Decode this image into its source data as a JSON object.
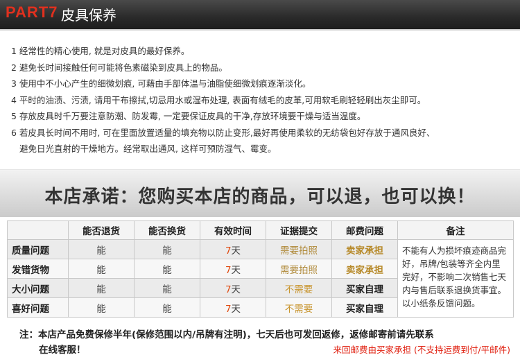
{
  "header": {
    "part": "PART7",
    "title": "皮具保养"
  },
  "care": [
    "1 经常性的精心使用, 就是对皮具的最好保养。",
    "2 避免长时间接触任何可能将色素磁染到皮具上的物品。",
    "3 使用中不小心产生的细微划痕, 可藉由手部体温与油脂使细微划痕逐渐淡化。",
    "4 平时的油渍、污渍, 请用干布擦拭,切忌用水或湿布处理, 表面有绒毛的皮革,可用软毛刷轻轻刷出灰尘即可。",
    "5 存放皮具时千万要注意防潮、防发霉, 一定要保证皮具的干净,存放环境要干燥与适当温度。",
    "6 若皮具长时间不用时, 可在里面放置适量的填充物以防止变形,最好再使用柔软的无纺袋包好存放于通风良好、",
    "避免日光直射的干燥地方。经常取出通风, 这样可预防湿气、霉变。"
  ],
  "banner": "本店承诺：您购买本店的商品，可以退，也可以换！",
  "table": {
    "headers": [
      "",
      "能否退货",
      "能否换货",
      "有效时间",
      "证据提交",
      "邮费问题",
      "备注"
    ],
    "rows": [
      {
        "label": "质量问题",
        "ret": "能",
        "exch": "能",
        "days": "7",
        "unit": "天",
        "proof": "需要拍照",
        "fee": "卖家承担"
      },
      {
        "label": "发错货物",
        "ret": "能",
        "exch": "能",
        "days": "7",
        "unit": "天",
        "proof": "需要拍照",
        "fee": "卖家承担"
      },
      {
        "label": "大小问题",
        "ret": "能",
        "exch": "能",
        "days": "7",
        "unit": "天",
        "proof": "不需要",
        "fee": "买家自理"
      },
      {
        "label": "喜好问题",
        "ret": "能",
        "exch": "能",
        "days": "7",
        "unit": "天",
        "proof": "不需要",
        "fee": "买家自理"
      }
    ],
    "note": "不能有人为损坏痕迹商品完好，吊牌/包装等齐全内里完好，不影响二次销售七天内与售后联系退换货事宜。以小纸条反馈问题。"
  },
  "footer": {
    "line1": "注：本店产品免费保修半年(保修范围以内/吊牌有注明)，七天后也可发回返修，返修邮寄前请先联系",
    "line2": "在线客服！",
    "footnote": "来回邮费由买家承担 (不支持运费到付/平邮件)"
  }
}
